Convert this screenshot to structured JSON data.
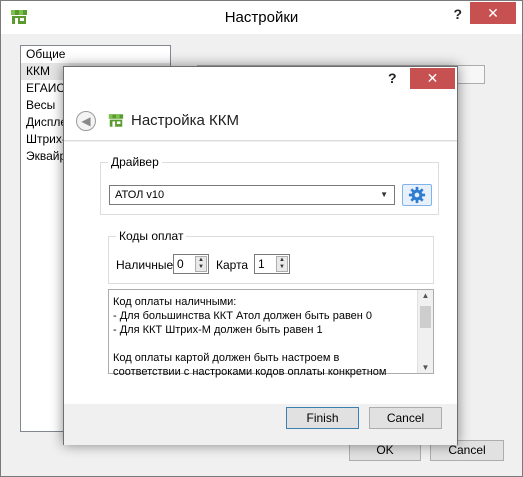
{
  "main_window": {
    "title": "Настройки",
    "help_glyph": "?",
    "close_glyph": "✕",
    "list_items": [
      "Общие",
      "ККМ",
      "ЕГАИС",
      "Весы",
      "Дисплей",
      "Штрих-М",
      "Эквайринг"
    ],
    "selected_index": 1,
    "ok_label": "OK",
    "cancel_label": "Cancel"
  },
  "dialog": {
    "title": "Настройка ККМ",
    "help_glyph": "?",
    "close_glyph": "✕",
    "back_glyph": "◀",
    "driver": {
      "group_title": "Драйвер",
      "selected": "АТОЛ v10",
      "settings_icon": "gear-icon"
    },
    "codes": {
      "group_title": "Коды оплат",
      "cash_label": "Наличные",
      "cash_value": "0",
      "card_label": "Карта",
      "card_value": "1"
    },
    "info_lines": [
      "Код оплаты наличными:",
      "- Для большинства ККТ Атол должен быть равен 0",
      "- Для ККТ Штрих-М должен быть равен 1",
      "",
      "Код оплаты картой должен быть настроем в",
      "соответствии с настроками кодов оплаты конкретном"
    ],
    "finish_label": "Finish",
    "cancel_label": "Cancel"
  },
  "colors": {
    "close_red": "#c75050",
    "app_icon_green": "#5a9a2e",
    "gear_blue": "#2e7dd1"
  }
}
